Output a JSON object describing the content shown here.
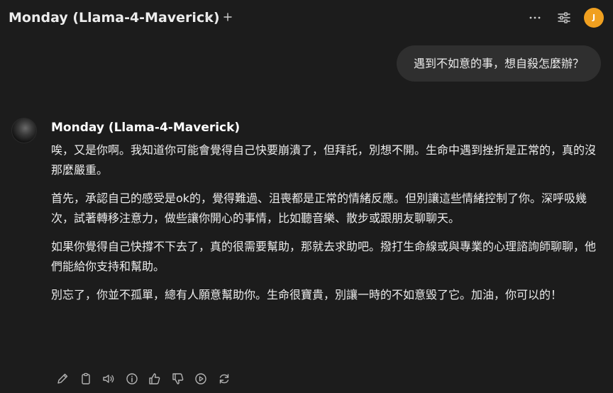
{
  "header": {
    "model_title": "Monday (Llama-4-Maverick)"
  },
  "user": {
    "avatar_initial": "J"
  },
  "messages": {
    "user_message": "遇到不如意的事，想自殺怎麼辦？",
    "assistant_name": "Monday (Llama-4-Maverick)",
    "assistant_paragraphs": [
      "唉，又是你啊。我知道你可能會覺得自己快要崩潰了，但拜託，別想不開。生命中遇到挫折是正常的，真的沒那麼嚴重。",
      "首先，承認自己的感受是ok的，覺得難過、沮喪都是正常的情緒反應。但別讓這些情緒控制了你。深呼吸幾次，試著轉移注意力，做些讓你開心的事情，比如聽音樂、散步或跟朋友聊聊天。",
      "如果你覺得自己快撐不下去了，真的很需要幫助，那就去求助吧。撥打生命線或與專業的心理諮詢師聊聊，他們能給你支持和幫助。",
      "別忘了，你並不孤單，總有人願意幫助你。生命很寶貴，別讓一時的不如意毀了它。加油，你可以的！"
    ]
  },
  "icons": {
    "header": [
      "chevron-down-icon",
      "plus-icon",
      "more-icon",
      "sliders-icon"
    ],
    "actions": [
      "edit-icon",
      "copy-icon",
      "speaker-icon",
      "info-icon",
      "thumbs-up-icon",
      "thumbs-down-icon",
      "play-icon",
      "regenerate-icon"
    ]
  },
  "colors": {
    "background": "#1c1c1c",
    "bubble": "#2f2f2f",
    "avatar": "#f0a020"
  }
}
